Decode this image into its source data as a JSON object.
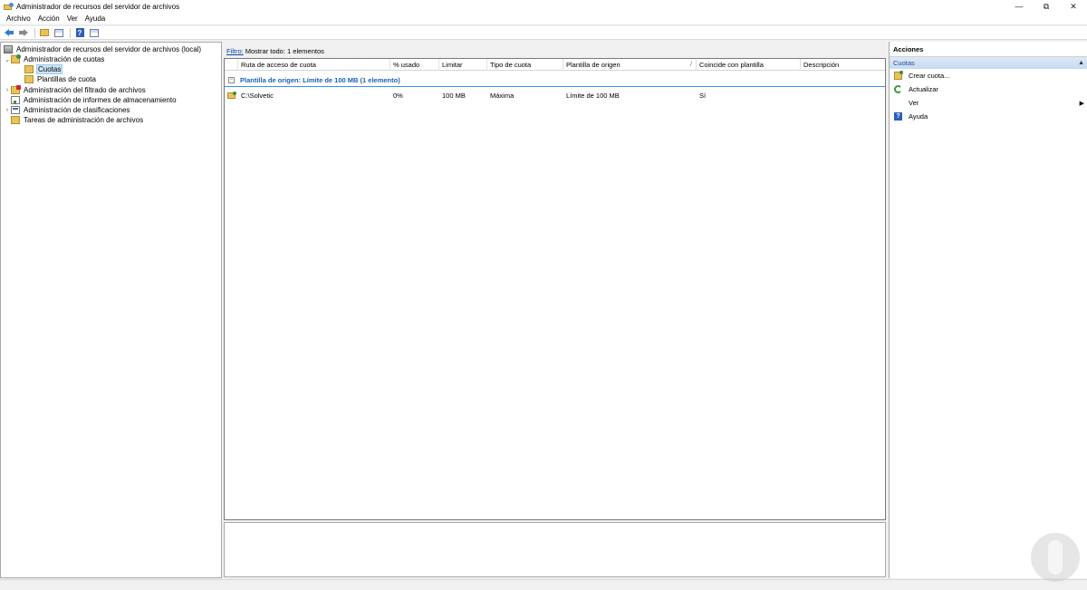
{
  "window": {
    "title": "Administrador de recursos del servidor de archivos",
    "controls": [
      "—",
      "⧉",
      "✕"
    ]
  },
  "menu": [
    "Archivo",
    "Acción",
    "Ver",
    "Ayuda"
  ],
  "tree": {
    "root": "Administrador de recursos del servidor de archivos (local)",
    "items": [
      {
        "label": "Administración de cuotas",
        "expander": "⌄"
      },
      {
        "label": "Cuotas",
        "selected": true
      },
      {
        "label": "Plantillas de cuota"
      },
      {
        "label": "Administración del filtrado de archivos",
        "expander": "›"
      },
      {
        "label": "Administración de informes de almacenamiento"
      },
      {
        "label": "Administración de clasificaciones",
        "expander": "›"
      },
      {
        "label": "Tareas de administración de archivos"
      }
    ]
  },
  "filter": {
    "link": "Filtro:",
    "text": "Mostrar todo: 1 elementos"
  },
  "table": {
    "columns": [
      "Ruta de acceso de cuota",
      "% usado",
      "Limitar",
      "Tipo de cuota",
      "Plantilla de origen",
      "Coincide con plantilla",
      "Descripción"
    ],
    "sort_indicator": "/",
    "group": {
      "toggle": "−",
      "label": "Plantilla de origen: Límite de 100 MB (1 elemento)"
    },
    "rows": [
      [
        "C:\\Solvetic",
        "0%",
        "100 MB",
        "Máxima",
        "Límite de 100 MB",
        "Sí",
        ""
      ]
    ]
  },
  "actions": {
    "title": "Acciones",
    "section": "Cuotas",
    "section_caret": "▲",
    "items": [
      {
        "label": "Crear cuota...",
        "icon": "create-quota-icon"
      },
      {
        "label": "Actualizar",
        "icon": "refresh-icon"
      },
      {
        "label": "Ver",
        "icon": "",
        "submenu": "▶"
      },
      {
        "label": "Ayuda",
        "icon": "help-icon"
      }
    ]
  }
}
